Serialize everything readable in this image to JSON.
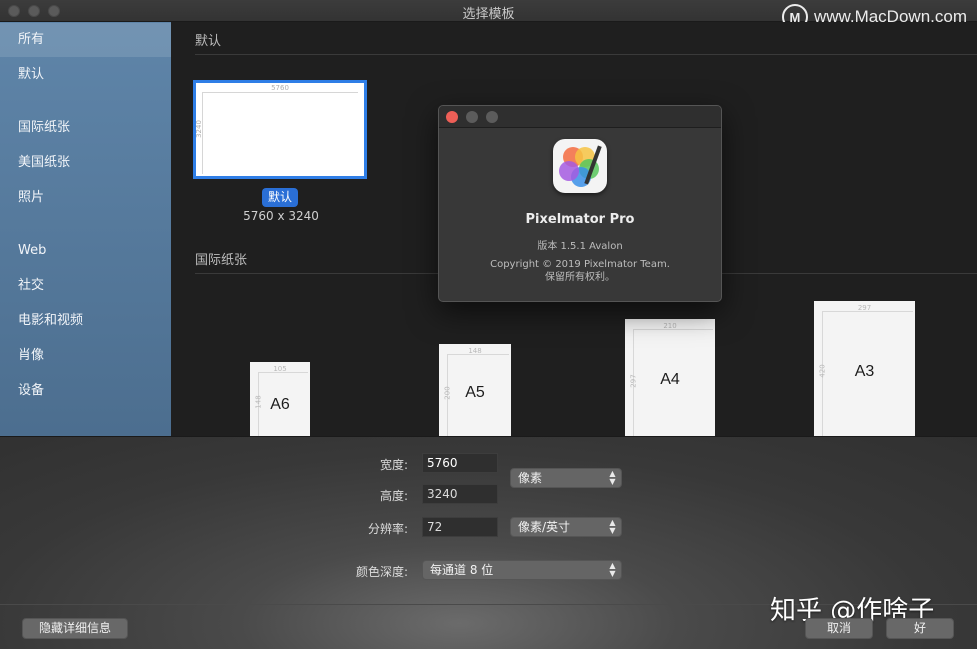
{
  "window": {
    "title": "选择模板"
  },
  "watermark": {
    "site": "www.MacDown.com",
    "logo_letter": "M",
    "author": "知乎 @作啥子"
  },
  "sidebar": {
    "items": [
      {
        "label": "所有",
        "selected": true
      },
      {
        "label": "默认"
      },
      {
        "label": "国际纸张"
      },
      {
        "label": "美国纸张"
      },
      {
        "label": "照片"
      },
      {
        "label": "Web"
      },
      {
        "label": "社交"
      },
      {
        "label": "电影和视频"
      },
      {
        "label": "肖像"
      },
      {
        "label": "设备"
      }
    ]
  },
  "sections": {
    "default": {
      "title": "默认",
      "template": {
        "badge": "默认",
        "size": "5760 x 3240",
        "dim_w": "5760",
        "dim_h": "3240"
      }
    },
    "international": {
      "title": "国际纸张",
      "papers": [
        {
          "name": "A6",
          "w": "105",
          "h": "148"
        },
        {
          "name": "A5",
          "w": "148",
          "h": "200"
        },
        {
          "name": "A4",
          "w": "210",
          "h": "297"
        },
        {
          "name": "A3",
          "w": "297",
          "h": "420"
        }
      ]
    }
  },
  "about": {
    "app_name": "Pixelmator Pro",
    "version": "版本 1.5.1 Avalon",
    "copyright": "Copyright © 2019 Pixelmator Team.",
    "rights": "保留所有权利。"
  },
  "settings": {
    "width": {
      "label": "宽度:",
      "value": "5760"
    },
    "height": {
      "label": "高度:",
      "value": "3240"
    },
    "unit": {
      "value": "像素"
    },
    "resolution": {
      "label": "分辨率:",
      "value": "72",
      "unit": "像素/英寸"
    },
    "color_depth": {
      "label": "颜色深度:",
      "value": "每通道 8 位"
    }
  },
  "buttons": {
    "hide_details": "隐藏详细信息",
    "cancel": "取消",
    "ok": "好"
  },
  "colors": {
    "sidebar": "#5a7ea2",
    "selection": "#2f7ee6",
    "badge": "#2a6fd6"
  }
}
